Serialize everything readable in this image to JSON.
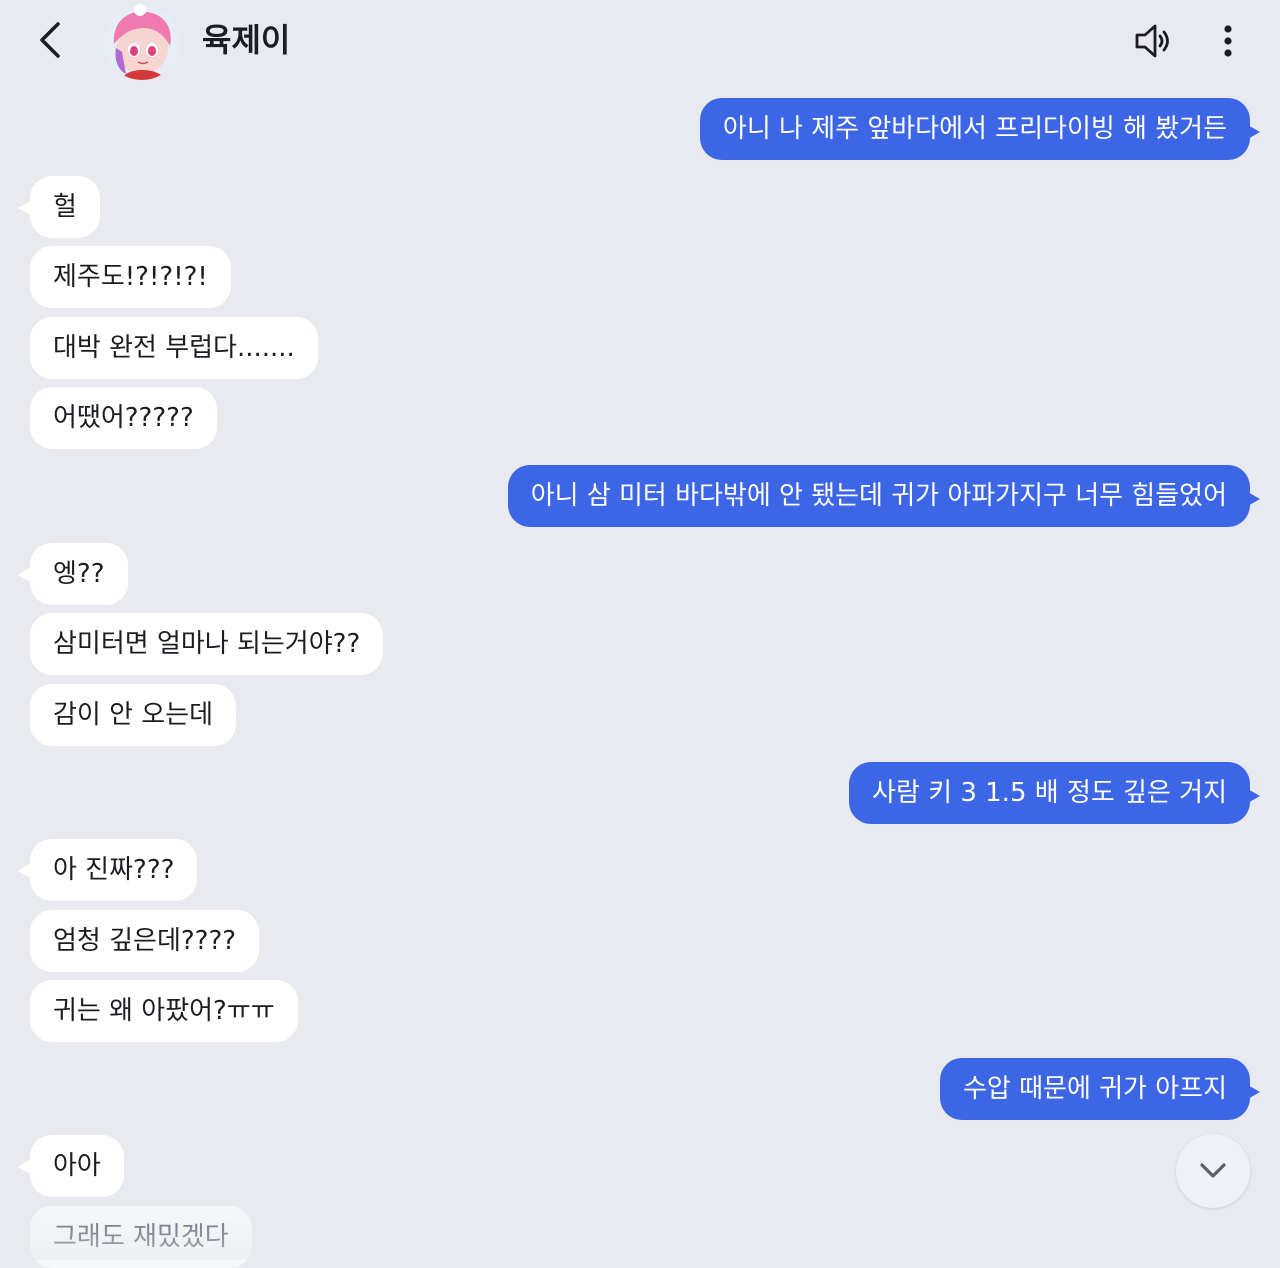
{
  "header": {
    "title": "육제이",
    "back_icon": "chevron-left-icon",
    "sound_icon": "speaker-icon",
    "menu_icon": "more-vertical-icon",
    "avatar": "character-avatar"
  },
  "colors": {
    "background": "#e8eaef",
    "outgoing_bubble": "#3d66e6",
    "incoming_bubble": "#ffffff",
    "text_dark": "#1c1d22"
  },
  "messages": [
    {
      "side": "out",
      "text": "아니 나 제주 앞바다에서 프리다이빙 해 봤거든"
    },
    {
      "side": "in",
      "text": "헐"
    },
    {
      "side": "in",
      "text": "제주도!?!?!?!"
    },
    {
      "side": "in",
      "text": "대박 완전 부럽다......."
    },
    {
      "side": "in",
      "text": "어땠어?????"
    },
    {
      "side": "out",
      "text": "아니 삼 미터 바다밖에 안 됐는데 귀가 아파가지구 너무 힘들었어"
    },
    {
      "side": "in",
      "text": "엥??"
    },
    {
      "side": "in",
      "text": "삼미터면 얼마나 되는거야??"
    },
    {
      "side": "in",
      "text": "감이 안 오는데"
    },
    {
      "side": "out",
      "text": "사람 키 3 1.5 배 정도 깊은 거지"
    },
    {
      "side": "in",
      "text": "아 진짜???"
    },
    {
      "side": "in",
      "text": "엄청 깊은데????"
    },
    {
      "side": "in",
      "text": "귀는 왜 아팠어?ㅠㅠ"
    },
    {
      "side": "out",
      "text": "수압 때문에 귀가 아프지"
    },
    {
      "side": "in",
      "text": "아아"
    },
    {
      "side": "in",
      "text": "그래도 재밌겠다"
    }
  ],
  "scroll_down_icon": "chevron-down-icon"
}
